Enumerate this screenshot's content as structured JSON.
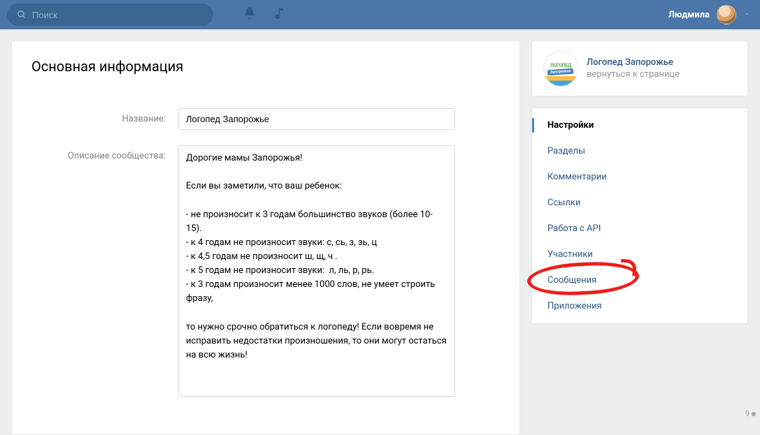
{
  "header": {
    "search_placeholder": "Поиск",
    "user_name": "Людмила"
  },
  "main": {
    "title": "Основная информация",
    "name_label": "Название:",
    "name_value": "Логопед Запорожье",
    "description_label": "Описание сообщества:",
    "description_value": "Дорогие мамы Запорожья!\n\nЕсли вы заметили, что ваш ребенок:\n\n- не произносит к 3 годам большинство звуков (более 10-15).\n- к 4 годам не произносит звуки: с, сь, з, зь, ц\n- к 4,5 годам не произносит ш, щ, ч .\n- к 5 годам не произносит звуки:  л, ль, р, рь.\n- к 3 годам произносит менее 1000 слов, не умеет строить фразу,\n\nто нужно срочно обратиться к логопеду! Если вовремя не исправить недостатки произношения, то они могут остаться на всю жизнь!"
  },
  "community": {
    "logo_top": "ЛОГОПЕД",
    "logo_band": "Запорожье",
    "title": "Логопед Запорожье",
    "back_label": "вернуться к странице"
  },
  "nav": {
    "items": [
      {
        "label": "Настройки"
      },
      {
        "label": "Разделы"
      },
      {
        "label": "Комментарии"
      },
      {
        "label": "Ссылки"
      },
      {
        "label": "Работа с API"
      },
      {
        "label": "Участники"
      },
      {
        "label": "Сообщения"
      },
      {
        "label": "Приложения"
      }
    ],
    "active_index": 0,
    "highlighted_index": 5
  },
  "corner": {
    "value": "9"
  }
}
